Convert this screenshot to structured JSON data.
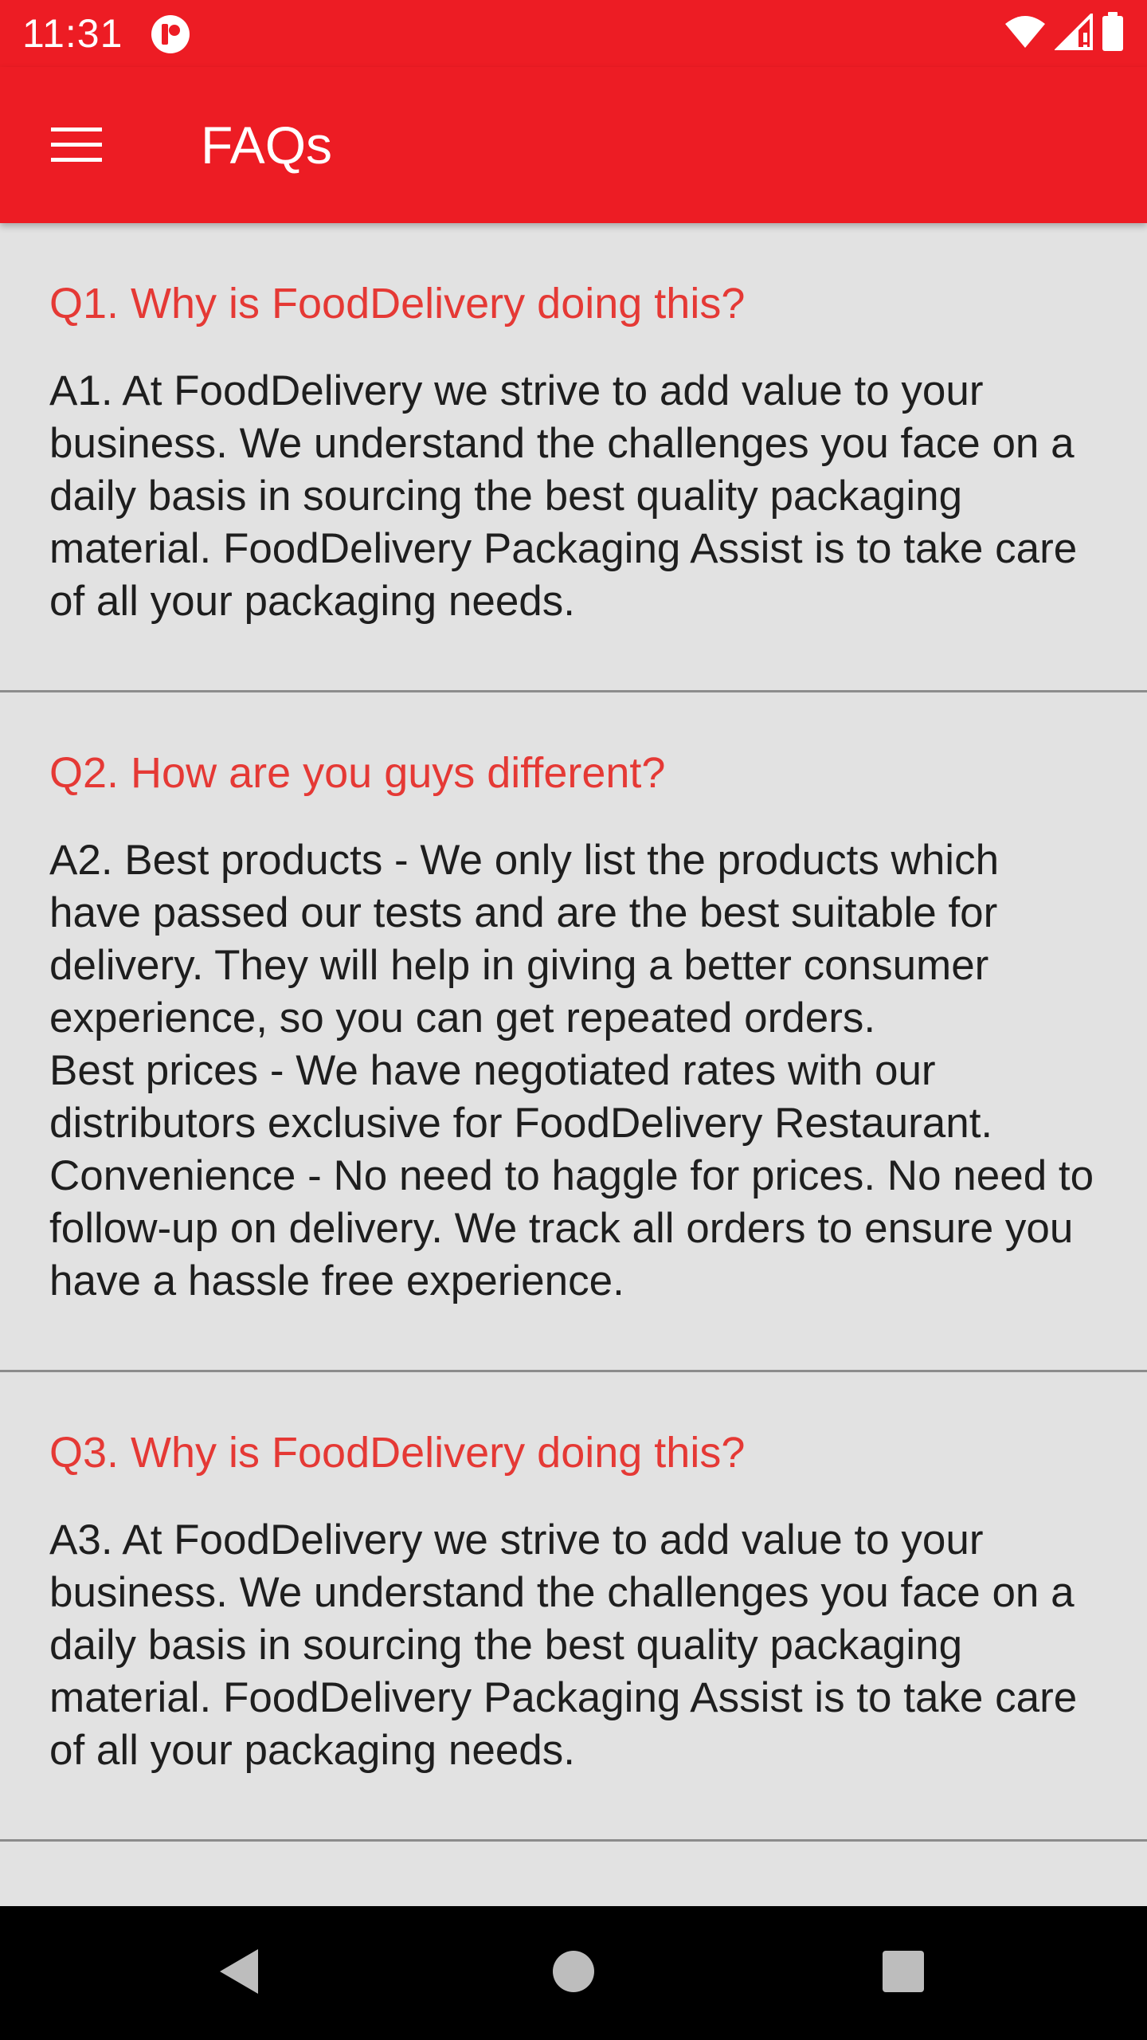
{
  "status_bar": {
    "time": "11:31",
    "app_icon": "app-notification-icon",
    "icons": [
      "wifi-icon",
      "cellular-signal-icon",
      "battery-icon"
    ]
  },
  "app_bar": {
    "title": "FAQs",
    "menu_icon": "hamburger-menu-icon",
    "background_color": "#ed1c24"
  },
  "faqs": [
    {
      "question": "Q1. Why is FoodDelivery doing this?",
      "answer": "A1. At FoodDelivery we strive to add value to your business. We understand the challenges you face on a daily basis in sourcing the best quality packaging material. FoodDelivery Packaging Assist is to take care of all your packaging needs."
    },
    {
      "question": "Q2. How are you guys different?",
      "answer": "A2. Best products - We only list the products which have passed our tests and are the best suitable for delivery. They will help in giving a better consumer experience, so you can get repeated orders.\nBest prices - We have negotiated rates with our distributors exclusive for FoodDelivery Restaurant.\nConvenience - No need to haggle for prices. No need to follow-up on delivery. We track all orders to ensure you have a hassle free experience."
    },
    {
      "question": "Q3. Why is FoodDelivery doing this?",
      "answer": "A3. At FoodDelivery we strive to add value to your business. We understand the challenges you face on a daily basis in sourcing the best quality packaging material. FoodDelivery Packaging Assist is to take care of all your packaging needs."
    }
  ],
  "nav_bar": {
    "buttons": [
      "back-icon",
      "home-icon",
      "recents-icon"
    ]
  },
  "colors": {
    "accent": "#ed1c24",
    "question_text": "#e53935",
    "background": "#e2e2e2"
  }
}
